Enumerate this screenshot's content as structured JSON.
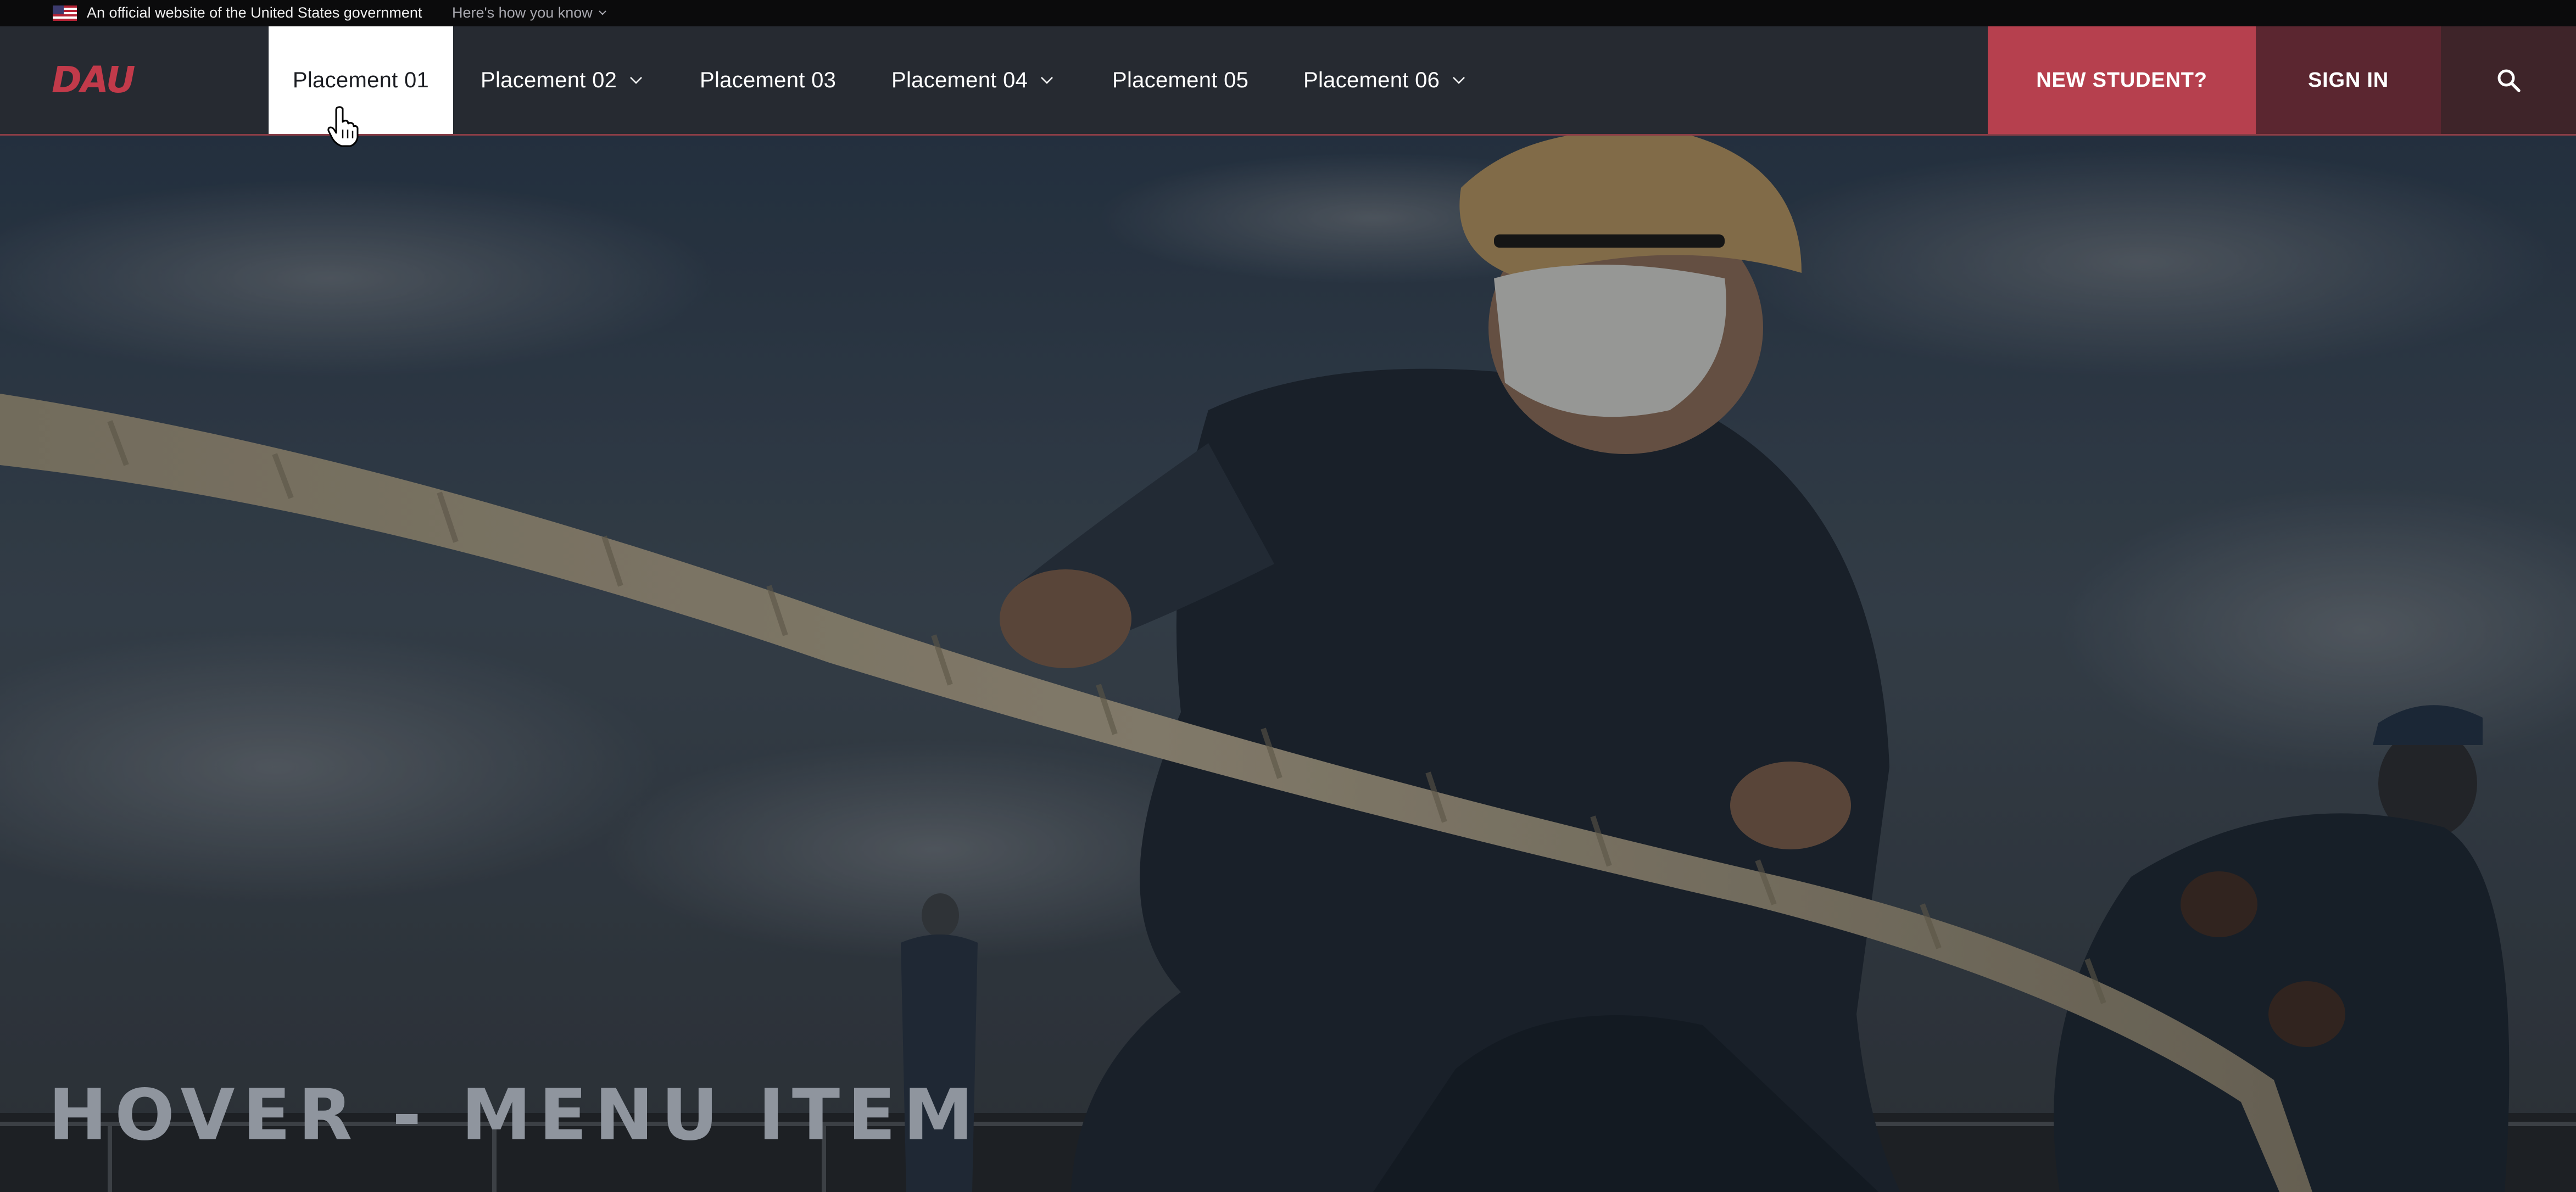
{
  "gov_banner": {
    "text": "An official website of the United States government",
    "link_text": "Here's how you know"
  },
  "header": {
    "logo_text": "DAU",
    "nav": [
      {
        "label": "Placement 01",
        "has_dropdown": false,
        "active": true
      },
      {
        "label": "Placement 02",
        "has_dropdown": true,
        "active": false
      },
      {
        "label": "Placement 03",
        "has_dropdown": false,
        "active": false
      },
      {
        "label": "Placement 04",
        "has_dropdown": true,
        "active": false
      },
      {
        "label": "Placement 05",
        "has_dropdown": false,
        "active": false
      },
      {
        "label": "Placement 06",
        "has_dropdown": true,
        "active": false
      }
    ],
    "new_student_label": "NEW STUDENT?",
    "sign_in_label": "SIGN IN",
    "search_icon": "search-icon"
  },
  "hero": {
    "title": "HOVER - MENU ITEM"
  },
  "colors": {
    "accent": "#b6404e",
    "accent_dark": "#5b2630",
    "header_bg": "#262a31",
    "banner_bg": "#0b0b0c"
  }
}
